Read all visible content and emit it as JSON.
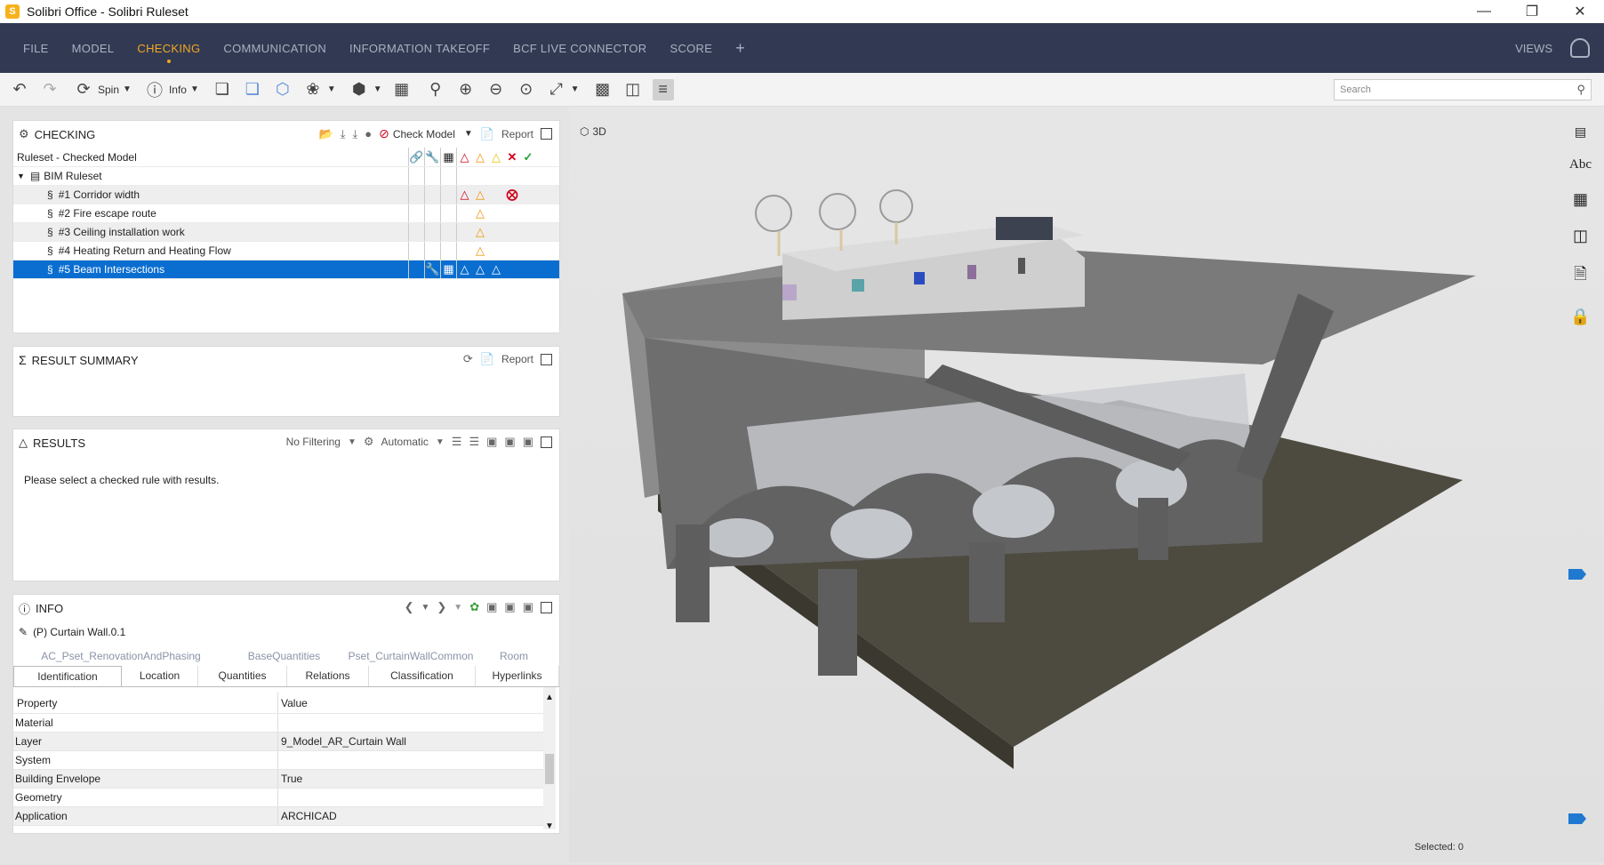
{
  "window": {
    "title": "Solibri Office - Solibri Ruleset",
    "app_icon": "S"
  },
  "menu": {
    "items": [
      "FILE",
      "MODEL",
      "CHECKING",
      "COMMUNICATION",
      "INFORMATION TAKEOFF",
      "BCF LIVE CONNECTOR",
      "SCORE"
    ],
    "active": "CHECKING",
    "views_label": "VIEWS"
  },
  "toolbar": {
    "spin_label": "Spin",
    "info_label": "Info",
    "search_placeholder": "Search"
  },
  "checking": {
    "title": "CHECKING",
    "check_model_label": "Check Model",
    "report_label": "Report",
    "header_label": "Ruleset - Checked Model",
    "tree_root": "BIM Ruleset",
    "rules": [
      {
        "name": "#1 Corridor width",
        "icons": [
          "tri-red",
          "tri-org",
          "x-red"
        ]
      },
      {
        "name": "#2 Fire escape route",
        "icons": [
          "tri-org"
        ]
      },
      {
        "name": "#3 Ceiling installation work",
        "icons": [
          "tri-org"
        ]
      },
      {
        "name": "#4 Heating Return and Heating Flow",
        "icons": [
          "tri-org"
        ]
      },
      {
        "name": "#5 Beam Intersections",
        "icons": [
          "tri-red",
          "tri-org",
          "tri-yel"
        ],
        "selected": true
      }
    ]
  },
  "result_summary": {
    "title": "RESULT SUMMARY",
    "report_label": "Report"
  },
  "results": {
    "title": "RESULTS",
    "filter_label": "No Filtering",
    "mode_label": "Automatic",
    "message": "Please select a checked rule with results."
  },
  "info": {
    "title": "INFO",
    "object_name": "(P) Curtain Wall.0.1",
    "top_tabs": [
      "AC_Pset_RenovationAndPhasing",
      "BaseQuantities",
      "Pset_CurtainWallCommon",
      "Room"
    ],
    "tabs": [
      "Identification",
      "Location",
      "Quantities",
      "Relations",
      "Classification",
      "Hyperlinks"
    ],
    "active_tab": "Identification",
    "col_property": "Property",
    "col_value": "Value",
    "rows": [
      {
        "k": "Material",
        "v": ""
      },
      {
        "k": "Layer",
        "v": "9_Model_AR_Curtain Wall"
      },
      {
        "k": "System",
        "v": ""
      },
      {
        "k": "Building Envelope",
        "v": "True"
      },
      {
        "k": "Geometry",
        "v": ""
      },
      {
        "k": "Application",
        "v": "ARCHICAD"
      }
    ]
  },
  "view3d": {
    "label": "3D",
    "selected_text": "Selected: 0",
    "abc_label": "Abc"
  }
}
